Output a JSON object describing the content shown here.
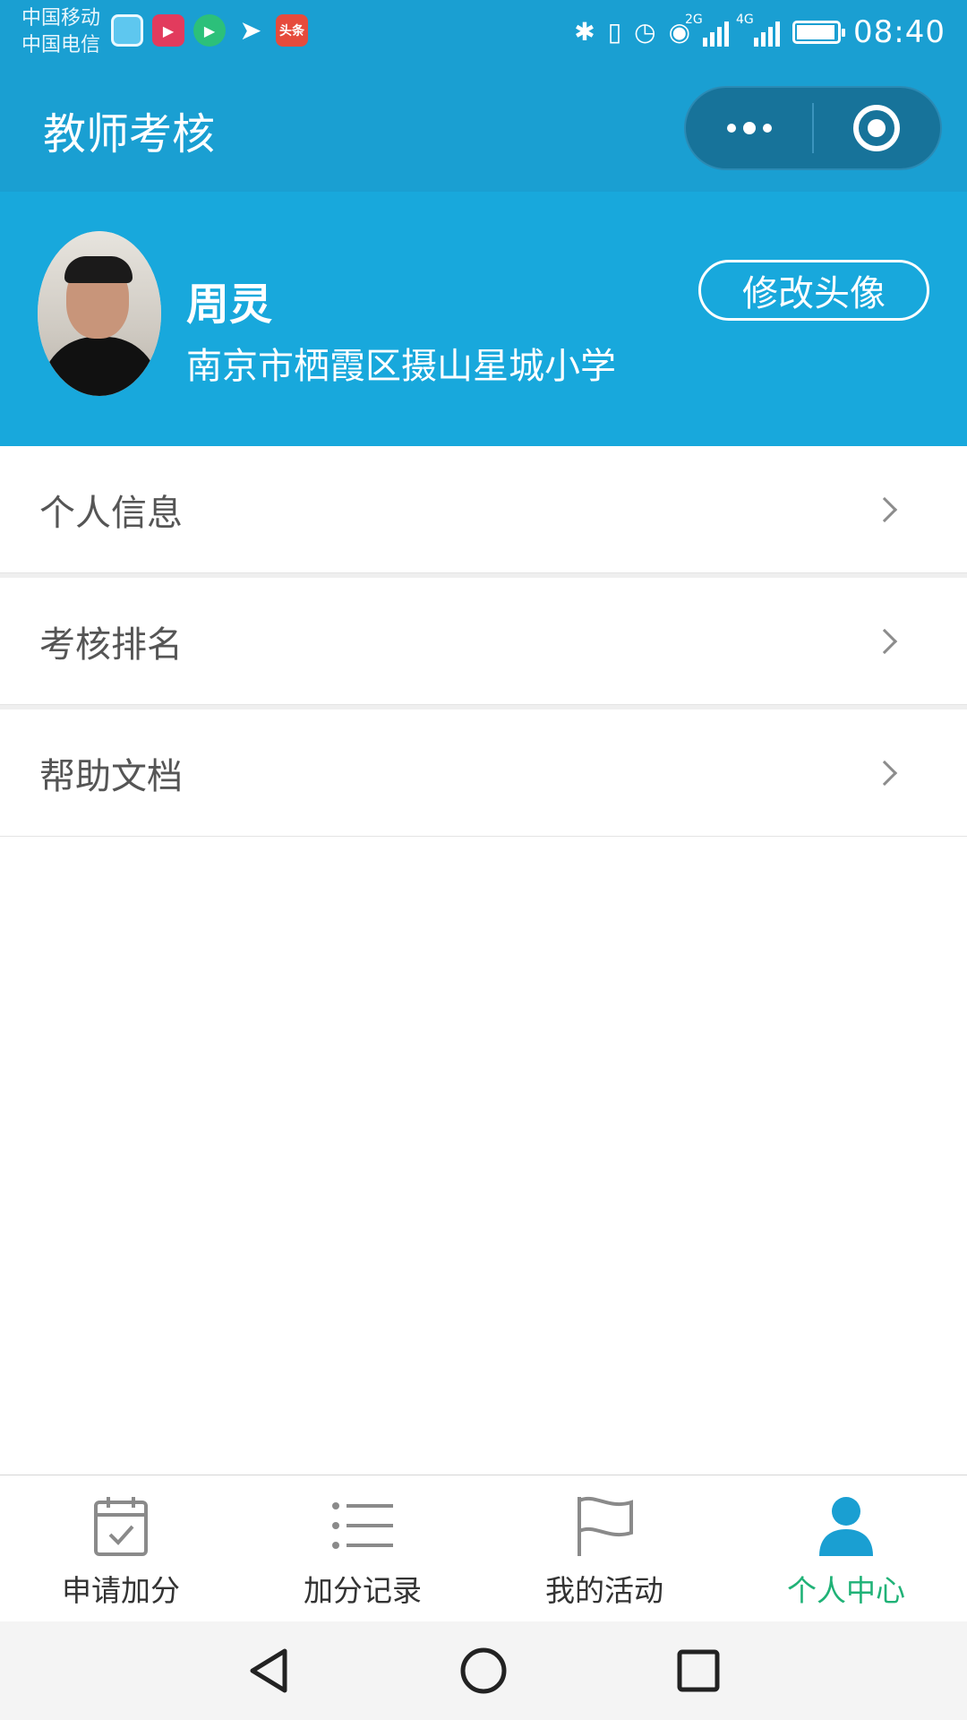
{
  "status_bar": {
    "carrier_1": "中国移动",
    "carrier_2": "中国电信",
    "network_1": "2G",
    "network_2": "4G",
    "time": "08:40",
    "notification_icons": [
      "qq-browser-icon",
      "video-app-icon",
      "iqiyi-icon",
      "dingtalk-icon",
      "toutiao-icon"
    ],
    "toutiao_label": "头条"
  },
  "nav": {
    "title": "教师考核"
  },
  "profile": {
    "name": "周灵",
    "school": "南京市栖霞区摄山星城小学",
    "change_avatar_label": "修改头像"
  },
  "menu": {
    "items": [
      {
        "label": "个人信息"
      },
      {
        "label": "考核排名"
      },
      {
        "label": "帮助文档"
      }
    ]
  },
  "tabbar": {
    "items": [
      {
        "label": "申请加分",
        "icon": "calendar-check-icon"
      },
      {
        "label": "加分记录",
        "icon": "list-icon"
      },
      {
        "label": "我的活动",
        "icon": "flag-icon"
      },
      {
        "label": "个人中心",
        "icon": "person-icon"
      }
    ],
    "active_index": 3
  },
  "colors": {
    "header_blue": "#1a9fd2",
    "profile_blue": "#18a8dc",
    "active_green": "#20b277",
    "active_icon_blue": "#1a9fd2"
  }
}
